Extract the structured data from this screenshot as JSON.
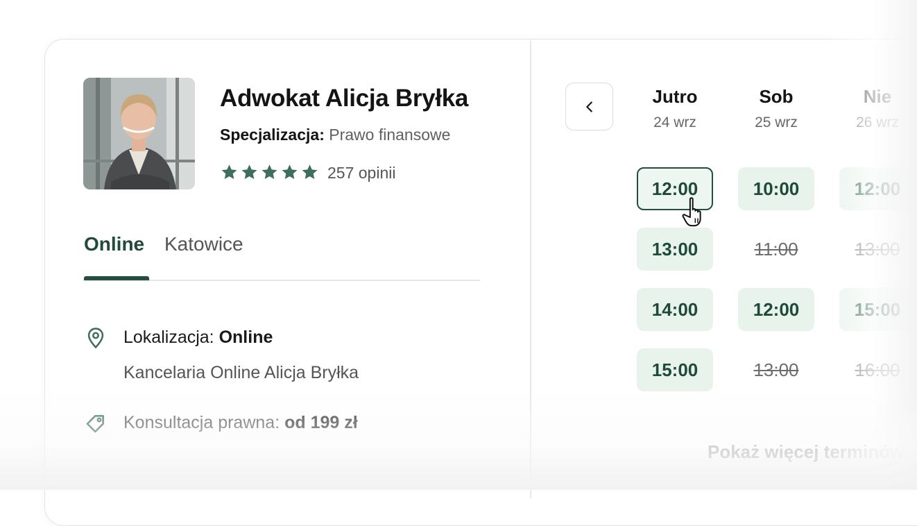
{
  "lawyer": {
    "name": "Adwokat Alicja Bryłka",
    "specialization_label": "Specjalizacja:",
    "specialization_value": "Prawo finansowe",
    "rating": 5,
    "rating_max": 5,
    "reviews": "257 opinii"
  },
  "tabs": [
    {
      "label": "Online",
      "active": true
    },
    {
      "label": "Katowice",
      "active": false
    }
  ],
  "details": {
    "location_label": "Lokalizacja:",
    "location_value": "Online",
    "office": "Kancelaria Online Alicja Bryłka",
    "service_label": "Konsultacja prawna:",
    "service_price": "od 199 zł"
  },
  "calendar": {
    "days": [
      {
        "name": "Jutro",
        "date": "24 wrz",
        "slots": [
          {
            "time": "12:00",
            "state": "selected"
          },
          {
            "time": "13:00",
            "state": "available"
          },
          {
            "time": "14:00",
            "state": "available"
          },
          {
            "time": "15:00",
            "state": "available"
          }
        ]
      },
      {
        "name": "Sob",
        "date": "25 wrz",
        "slots": [
          {
            "time": "10:00",
            "state": "available"
          },
          {
            "time": "11:00",
            "state": "taken"
          },
          {
            "time": "12:00",
            "state": "available"
          },
          {
            "time": "13:00",
            "state": "taken"
          }
        ]
      },
      {
        "name": "Nie",
        "date": "26 wrz",
        "slots": [
          {
            "time": "12:00",
            "state": "available"
          },
          {
            "time": "13:00",
            "state": "taken"
          },
          {
            "time": "15:00",
            "state": "available"
          },
          {
            "time": "16:00",
            "state": "taken"
          }
        ]
      }
    ],
    "more_label": "Pokaż więcej terminów"
  },
  "colors": {
    "accent": "#22503f",
    "slot_bg": "#e8f3ec",
    "star": "#3f6f5c"
  }
}
